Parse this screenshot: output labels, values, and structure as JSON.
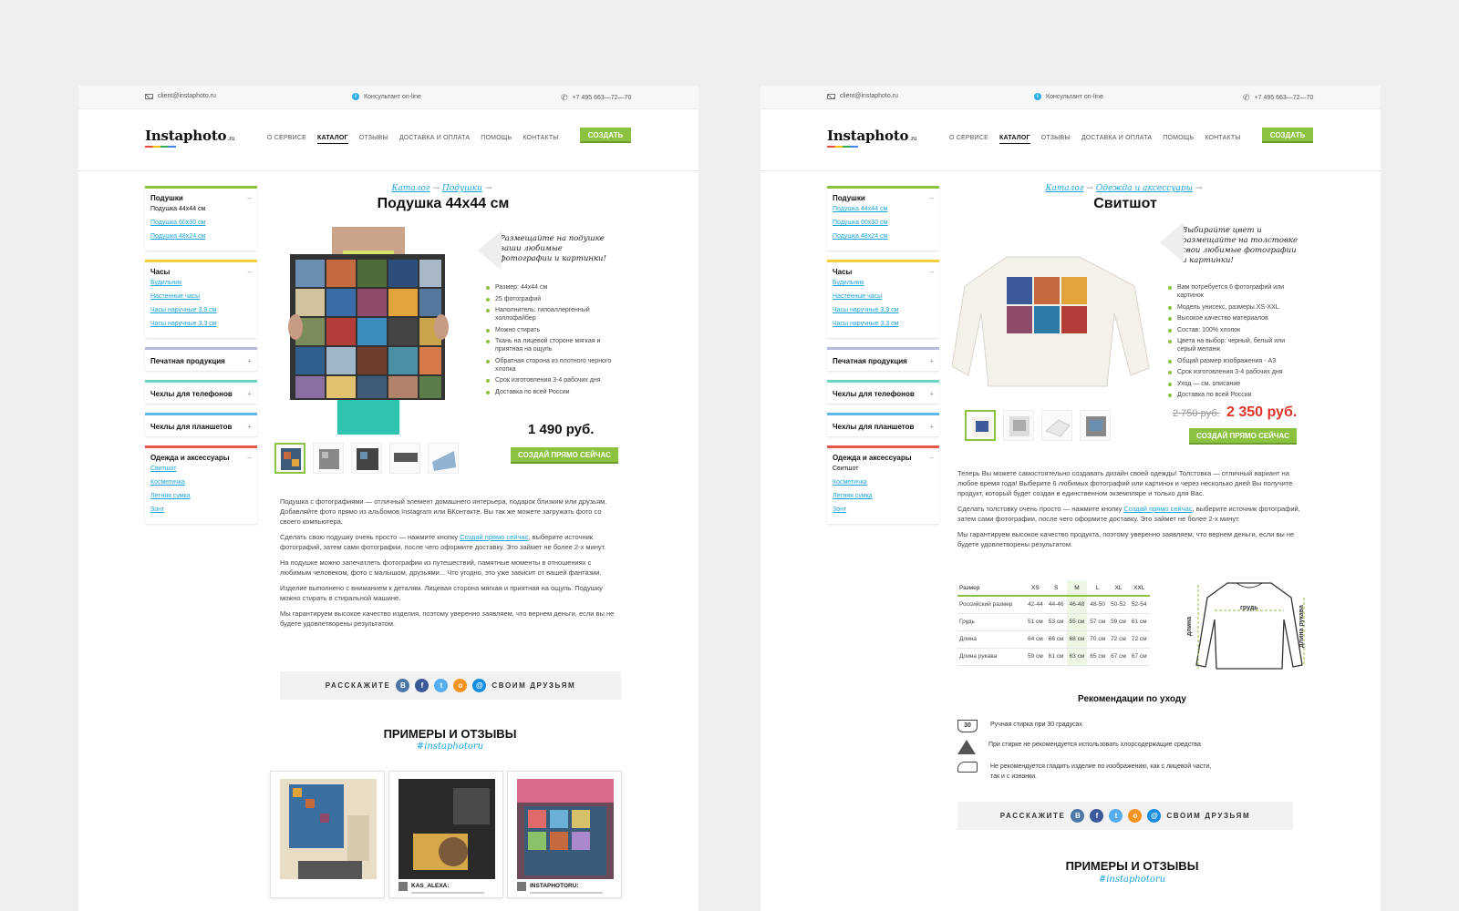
{
  "site": {
    "email": "client@instaphoto.ru",
    "consultant": "Консультант on-line",
    "phone": "+7 495 663—72—70",
    "logo_main": "Instaphoto",
    "logo_suffix": ".ru",
    "nav": [
      "О СЕРВИСЕ",
      "КАТАЛОГ",
      "ОТЗЫВЫ",
      "ДОСТАВКА И ОПЛАТА",
      "ПОМОЩЬ",
      "КОНТАКТЫ"
    ],
    "create_label": "СОЗДАТЬ"
  },
  "pageA": {
    "sidebar": [
      {
        "title": "Подушки",
        "toggle": "–",
        "items": [
          "Подушка 44x44 см",
          "Подушка 60x30 см",
          "Подушка 48x24 см"
        ]
      },
      {
        "title": "Часы",
        "toggle": "–",
        "items": [
          "Будильник",
          "Настенные часы",
          "Часы наручные 3,9 см",
          "Часы наручные 3,3 см"
        ]
      },
      {
        "title": "Печатная продукция",
        "toggle": "+",
        "items": []
      },
      {
        "title": "Чехлы для телефонов",
        "toggle": "+",
        "items": []
      },
      {
        "title": "Чехлы для планшетов",
        "toggle": "+",
        "items": []
      },
      {
        "title": "Одежда и аксессуары",
        "toggle": "–",
        "items": [
          "Свитшот",
          "Косметичка",
          "Летняя сумка",
          "Зонт"
        ]
      }
    ],
    "crumb1": "Каталог",
    "crumb2": "Подушки",
    "arrow": "→",
    "title": "Подушка 44x44 см",
    "quote": "Размещайте на подушке ваши любимые фотографии и картинки!",
    "features": [
      "Размер: 44x44 см",
      "25 фотографий",
      "Наполнитель: гипоаллергенный холлофайбер",
      "Можно стирать",
      "Ткань на лицевой стороне мягкая и приятная на ощупь",
      "Обратная сторона из плотного черного хлопка",
      "Срок изготовления 3-4 рабочих дня",
      "Доставка по всей России"
    ],
    "price": "1 490 руб.",
    "buy": "СОЗДАЙ ПРЯМО СЕЙЧАС",
    "desc": {
      "p1": "Подушка с фотографиями — отличный элемент домашнего интерьера, подарок близким или друзьям. Добавляйте фото прямо из альбомов Instagram или ВКонтакте. Вы так же можете загружать фото со своего компьютера.",
      "p2a": "Сделать свою подушку очень просто — нажмите кнопку ",
      "p2link": "Создай прямо сейчас",
      "p2b": ", выберите источник фотографий, затем сами фотографии, после чего оформите доставку. Это займет не более 2-х минут.",
      "p3": "На подушке можно запечатлеть фотографии из путешествий, памятные моменты в отношениях с любимым человеком, фото с малышом, друзьями... Что угодно, это уже зависит от вашей фантазии.",
      "p4": "Изделие выполнено с вниманием к деталям. Лицевая сторона мягкая и приятная на ощупь. Подушку можно стирать в стиральной машине.",
      "p5": "Мы гарантируем высокое качество изделия, поэтому уверенно заявляем, что вернем деньги, если вы не будете удовлетворены результатом."
    },
    "share_left": "РАССКАЖИТЕ",
    "share_right": "СВОИМ ДРУЗЬЯМ",
    "social": [
      "В",
      "f",
      "t",
      "о",
      "@"
    ],
    "examples_title": "ПРИМЕРЫ И ОТЗЫВЫ",
    "hashtag": "#instaphotoru",
    "reviews": [
      "KAS_ALEXA:",
      "INSTAPHOTORU:"
    ]
  },
  "pageB": {
    "sidebar": [
      {
        "title": "Подушки",
        "toggle": "–",
        "items": [
          "Подушка 44x44 см",
          "Подушка 60x30 см",
          "Подушка 48x24 см"
        ]
      },
      {
        "title": "Часы",
        "toggle": "–",
        "items": [
          "Будильник",
          "Настенные часы",
          "Часы наручные 3,9 см",
          "Часы наручные 3,3 см"
        ]
      },
      {
        "title": "Печатная продукция",
        "toggle": "+",
        "items": []
      },
      {
        "title": "Чехлы для телефонов",
        "toggle": "+",
        "items": []
      },
      {
        "title": "Чехлы для планшетов",
        "toggle": "+",
        "items": []
      },
      {
        "title": "Одежда и аксессуары",
        "toggle": "–",
        "items": [
          "Свитшот",
          "Косметичка",
          "Летняя сумка",
          "Зонт"
        ]
      }
    ],
    "crumb1": "Каталог",
    "crumb2": "Одежда и аксессуары",
    "arrow": "→",
    "title": "Свитшот",
    "quote": "Выбирайте цвет и размещайте на толстовке свои любимые фотографии и картинки!",
    "features": [
      "Вам потребуется 6 фотографий или картинок",
      "Модель унисекс, размеры XS-XXL",
      "Высокое качество материалов",
      "Состав: 100% хлопок",
      "Цвета на выбор: черный, белый или серый меланж",
      "Общий размер изображения - А3",
      "Срок изготовления 3-4 рабочих дня",
      "Уход — см. описание",
      "Доставка по всей России"
    ],
    "old_price": "2 750 руб.",
    "price": "2 350 руб.",
    "buy": "СОЗДАЙ ПРЯМО СЕЙЧАС",
    "desc": {
      "p1": "Теперь Вы можете самостоятельно создавать дизайн своей одежды! Толстовка — отличный вариант на любое время года! Выберите 6 любимых фотографий или картинок и через несколько дней Вы получите продукт, который будет создан в единственном экземпляре и только для Вас.",
      "p2a": "Сделать толстовку очень просто — нажмите кнопку ",
      "p2link": "Создай прямо сейчас",
      "p2b": ", выберите источник фотографий, затем сами фотографии, после чего оформите доставку. Это займет не более 2-х минут.",
      "p3": "Мы гарантируем высокое качество продукта, поэтому уверенно заявляем, что вернем деньги, если вы не будете удовлетворены результатом."
    },
    "size_table": {
      "headers": [
        "Размер",
        "XS",
        "S",
        "M",
        "L",
        "XL",
        "XXL"
      ],
      "rows": [
        [
          "Российский размер",
          "42-44",
          "44-46",
          "46-48",
          "48-50",
          "50-52",
          "52-54"
        ],
        [
          "Грудь",
          "51 см",
          "53 см",
          "55 см",
          "57 см",
          "59 см",
          "61 см"
        ],
        [
          "Длина",
          "64 см",
          "66 см",
          "68 см",
          "70 см",
          "72 см",
          "72 см"
        ],
        [
          "Длина рукава",
          "59 см",
          "61 см",
          "63 см",
          "65 см",
          "67 см",
          "67 см"
        ]
      ]
    },
    "diagram": {
      "chest": "грудь",
      "length": "длина",
      "sleeve": "длина рукава"
    },
    "care_title": "Рекомендации по уходу",
    "care": [
      "Ручная стирка при 30 градусах",
      "При стирке не рекомендуется использовать хлорсодержащие средства",
      "Не рекомендуется гладить изделие по изображению, как с лицевой части, так и с изнанки."
    ],
    "care_icon": "30",
    "share_left": "РАССКАЖИТЕ",
    "share_right": "СВОИМ ДРУЗЬЯМ",
    "social": [
      "В",
      "f",
      "t",
      "о",
      "@"
    ],
    "examples_title": "ПРИМЕРЫ И ОТЗЫВЫ",
    "hashtag": "#instaphotoru"
  },
  "colors": {
    "accent": "#8bc23f",
    "link": "#1ca3dc",
    "sale": "#e0342b"
  }
}
